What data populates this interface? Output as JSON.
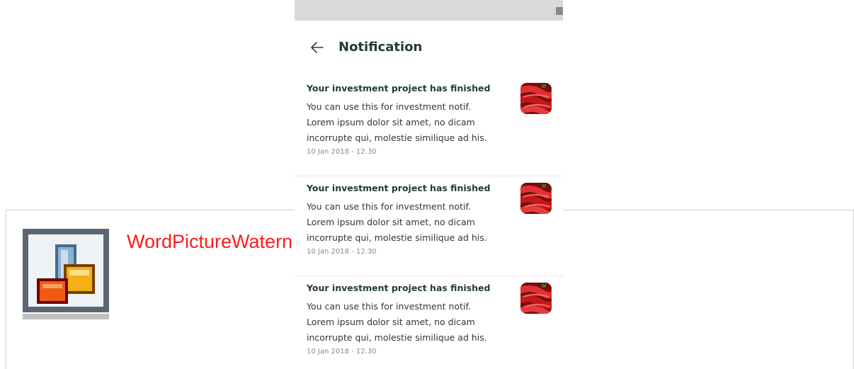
{
  "background": {
    "title": "WordPictureWatern"
  },
  "statusbar": {
    "icons": [
      "square-icon",
      "circle-icon",
      "triangle-icon"
    ]
  },
  "header": {
    "back_icon": "arrow-left-icon",
    "title": "Notification"
  },
  "notifications": [
    {
      "title": "Your investment project has finished",
      "body": [
        "You can use this for investment notif.",
        "Lorem ipsum dolor sit amet, no dicam",
        "incorrupte qui, molestie similique ad his."
      ],
      "time": "10 Jan 2018 - 12.30",
      "thumb": "red-chili-peppers-image"
    },
    {
      "title": "Your investment project has finished",
      "body": [
        "You can use this for investment notif.",
        "Lorem ipsum dolor sit amet, no dicam",
        "incorrupte qui, molestie similique ad his."
      ],
      "time": "10 Jan 2018 - 12.30",
      "thumb": "red-chili-peppers-image"
    },
    {
      "title": "Your investment project has finished",
      "body": [
        "You can use this for investment notif.",
        "Lorem ipsum dolor sit amet, no dicam",
        "incorrupte qui, molestie similique ad his."
      ],
      "time": "10 Jan 2018 - 12.30",
      "thumb": "red-chili-peppers-image"
    }
  ],
  "colors": {
    "title_text": "#1f3d2a",
    "status_bar": "#d9d9d9",
    "watermark_text": "#ff1a1a"
  }
}
